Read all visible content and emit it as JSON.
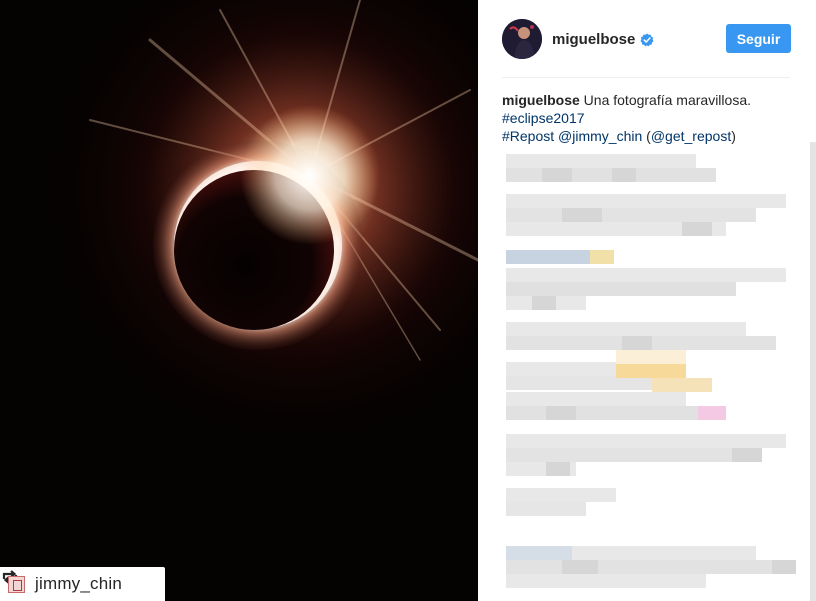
{
  "post": {
    "username": "miguelbose",
    "follow_label": "Seguir",
    "caption_user": "miguelbose",
    "caption_text": " Una fotografía maravillosa.",
    "hashtag": "#eclipse2017",
    "repost_line_start": "#Repost ",
    "repost_mention": "@jimmy_chin",
    "repost_line_paren_open": " (",
    "repost_via": "@get_repost",
    "repost_line_paren_close": ")"
  },
  "repost_badge": {
    "name": "jimmy_chin",
    "icon": "repost-icon"
  },
  "icons": {
    "verified": "verified-badge-icon",
    "repost": "repost-icon"
  },
  "colors": {
    "follow_button": "#3897f0",
    "link": "#003569",
    "verified": "#3897f0",
    "text": "#262626"
  }
}
